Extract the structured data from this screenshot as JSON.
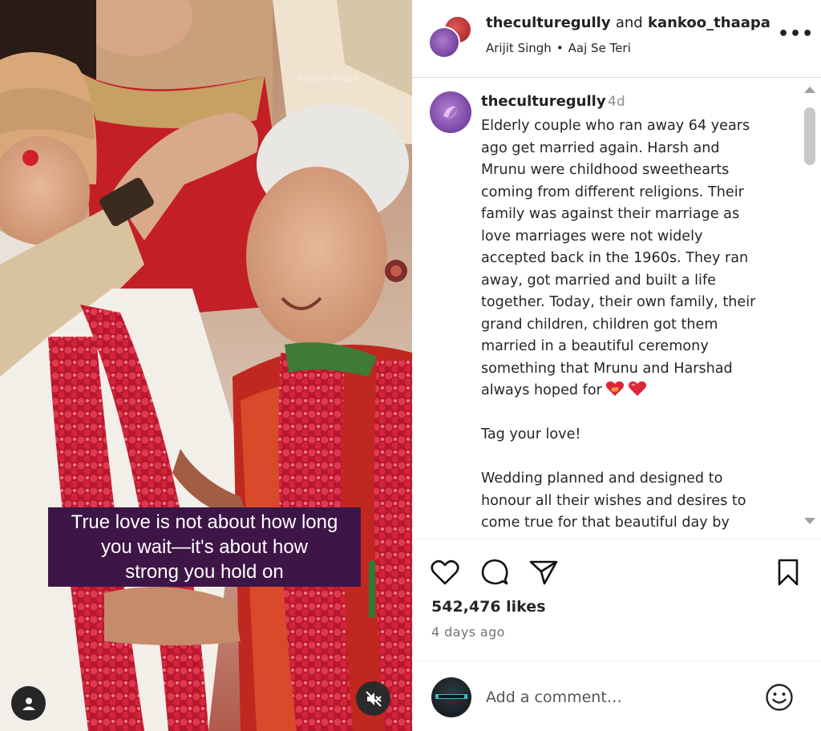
{
  "media": {
    "watermark": "kankoo_thaapa",
    "caption_lines": [
      "True love is not about how long",
      "you wait—it's about how",
      "strong you hold on"
    ],
    "user_button_icon": "user-icon",
    "mute_button_icon": "muted-speaker-icon"
  },
  "header": {
    "user1": "theculturegully",
    "connector": "and",
    "user2": "kankoo_thaapa",
    "audio_artist": "Arijit Singh",
    "audio_separator": "•",
    "audio_track": "Aaj Se Teri",
    "more_label": "•••"
  },
  "caption": {
    "username": "theculturegully",
    "time": "4d",
    "lines": [
      "Elderly couple who ran away 64 years",
      "ago get married again. Harsh and",
      "Mrunu were childhood sweethearts",
      "coming from different religions. Their",
      "family was against their marriage as",
      "love marriages were not widely",
      "accepted back in the 1960s. They ran",
      "away, got married and built a life",
      "together. Today, their own family, their",
      "grand children, children got them",
      "married in a beautiful ceremony",
      "something that Mrunu and Harshad",
      "always hoped for"
    ],
    "tag_line": "Tag your love!",
    "wedding_lines": [
      "Wedding planned and designed to",
      "honour all their wishes and desires to",
      "come true for that beautiful day by"
    ]
  },
  "actions": {
    "like_icon": "heart-icon",
    "comment_icon": "comment-bubble-icon",
    "share_icon": "paper-plane-icon",
    "save_icon": "bookmark-icon"
  },
  "likes": "542,476 likes",
  "posted": "4 days ago",
  "comment_bar": {
    "placeholder": "Add a comment…",
    "emoji_icon": "smiley-icon"
  },
  "colors": {
    "caption_box": "#3d1546",
    "heart_red": "#e0243a",
    "muted_text": "#8e8e8e"
  }
}
